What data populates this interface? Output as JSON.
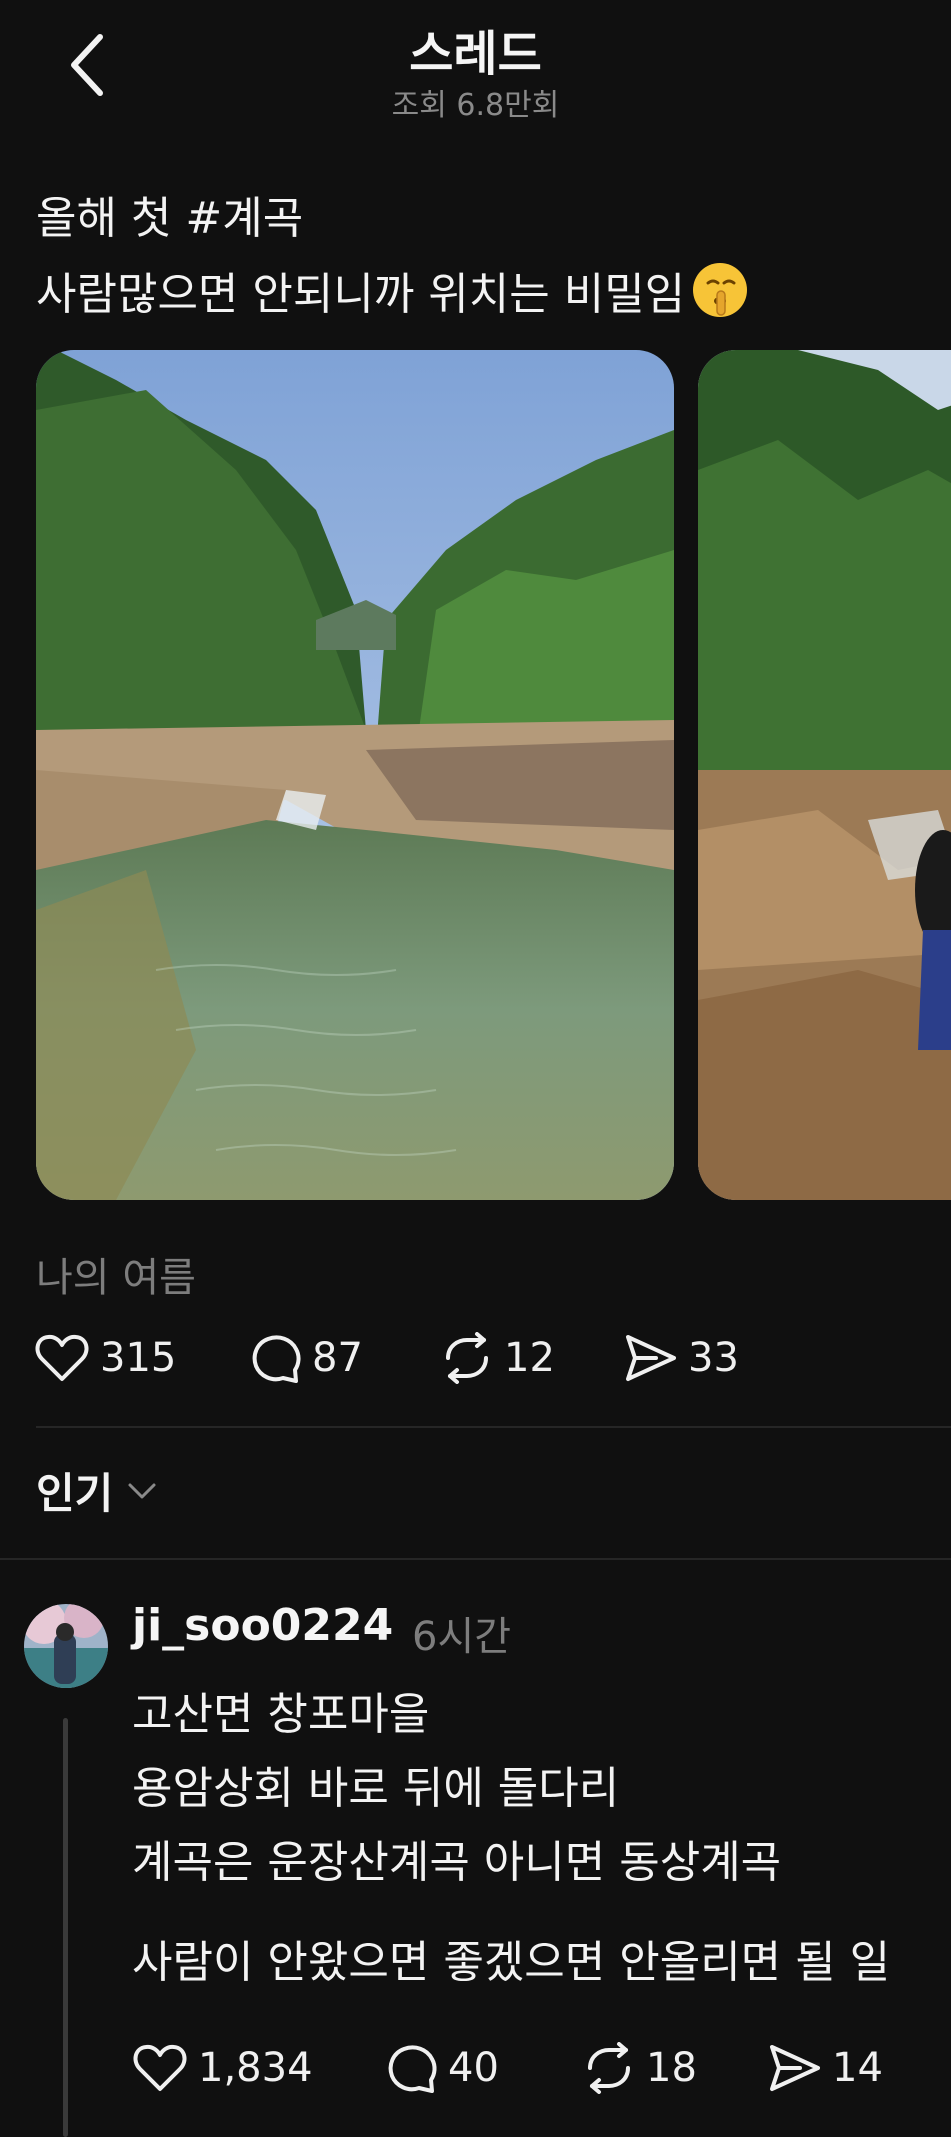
{
  "header": {
    "title": "스레드",
    "views": "조회 6.8만회"
  },
  "post": {
    "text_line1": "올해 첫 #계곡",
    "text_line2": "사람많으면 안되니까 위치는 비밀임",
    "emoji_icon": "shushing-face-icon",
    "caption": "나의 여름",
    "likes": "315",
    "comments": "87",
    "reposts": "12",
    "shares": "33"
  },
  "sort": {
    "label": "인기"
  },
  "comment": {
    "username": "ji_soo0224",
    "time": "6시간",
    "lines": [
      "고산면 창포마을",
      "용암상회 바로 뒤에 돌다리",
      "계곡은 운장산계곡 아니면 동상계곡",
      "사람이 안왔으면 좋겠으면 안올리면 될 일"
    ],
    "likes": "1,834",
    "replies": "40",
    "reposts": "18",
    "shares": "14"
  },
  "colors": {
    "background": "#101010",
    "text": "#f3f3f3",
    "muted": "#7d7d7d",
    "divider": "#262626"
  }
}
